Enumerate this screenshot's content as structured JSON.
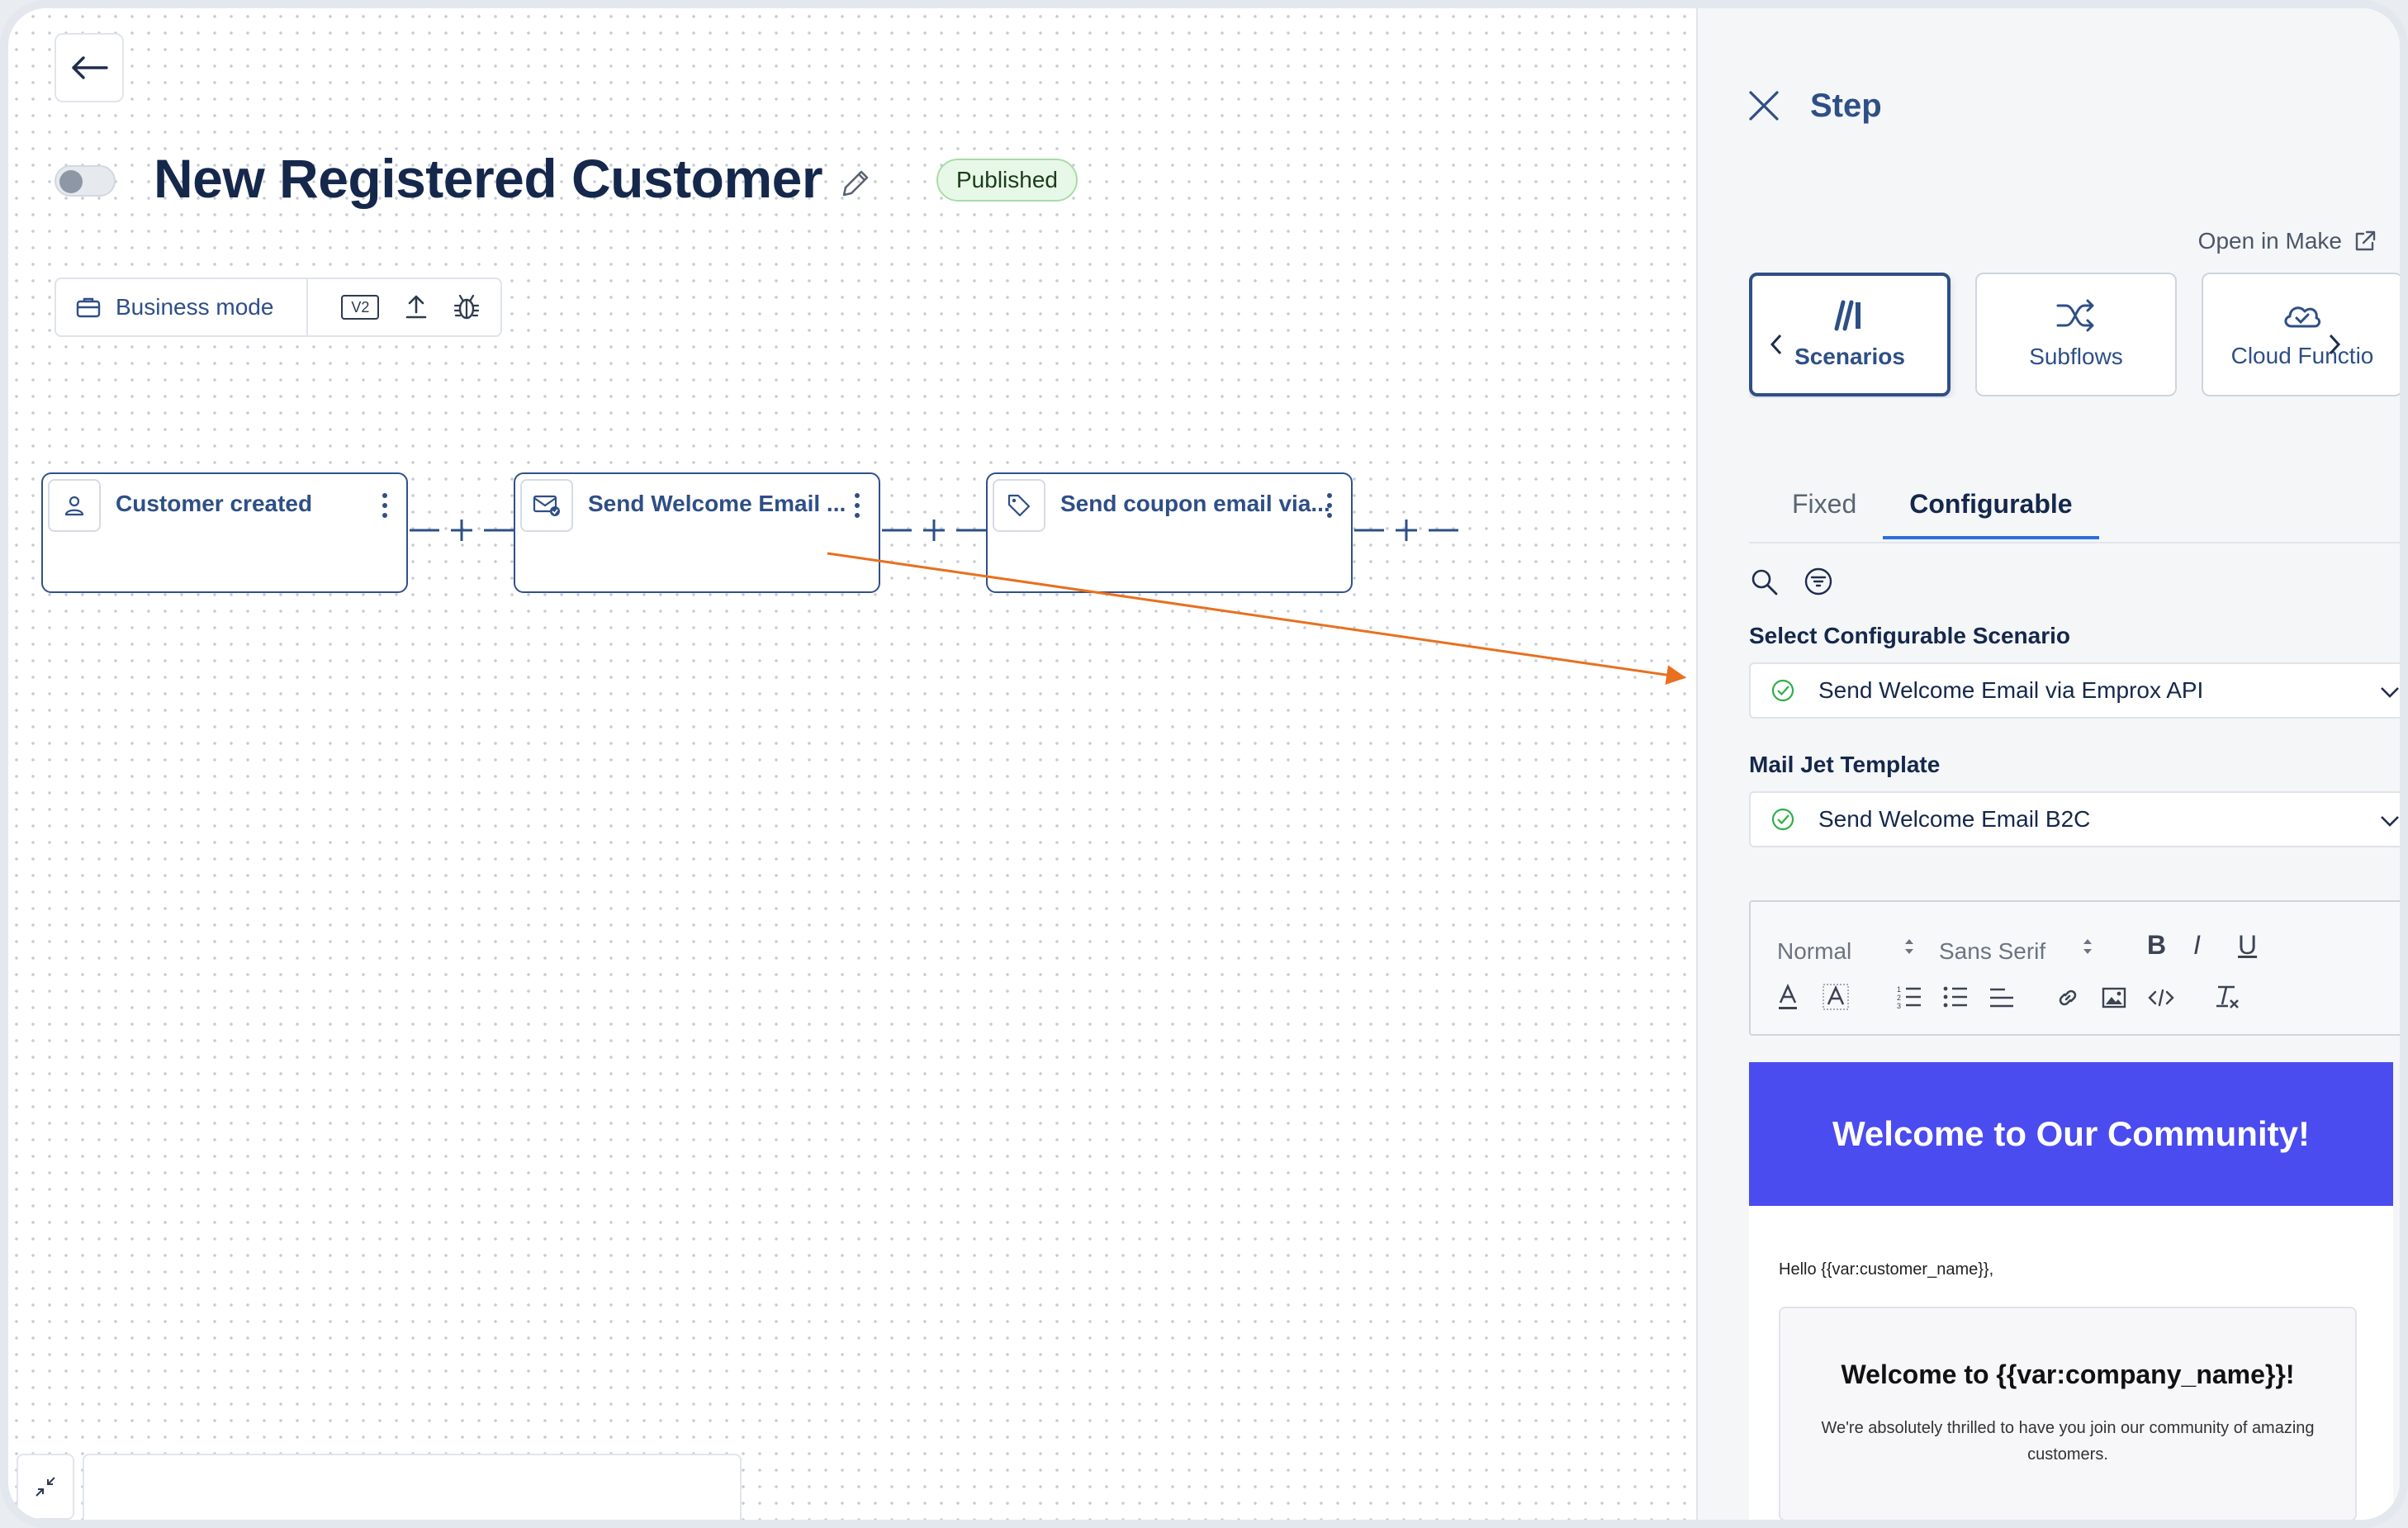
{
  "workflow": {
    "title": "New Registered Customer",
    "status": "Published",
    "enabled": false
  },
  "toolbar": {
    "mode_label": "Business mode",
    "version_label": "V2"
  },
  "nodes": [
    {
      "label": "Customer created",
      "icon": "user-icon"
    },
    {
      "label": "Send Welcome Email ...",
      "icon": "email-icon"
    },
    {
      "label": "Send coupon email via...",
      "icon": "tag-icon"
    }
  ],
  "connector": {
    "symbol": "+"
  },
  "panel": {
    "title": "Step",
    "open_in_make": "Open in Make",
    "categories": [
      {
        "label": "Scenarios",
        "icon": "scenarios-icon",
        "active": true
      },
      {
        "label": "Subflows",
        "icon": "shuffle-icon",
        "active": false
      },
      {
        "label": "Cloud Functio",
        "icon": "cloud-icon",
        "active": false
      }
    ],
    "tabs": [
      {
        "label": "Fixed",
        "active": false
      },
      {
        "label": "Configurable",
        "active": true
      }
    ],
    "scenario_label": "Select Configurable Scenario",
    "scenario_value": "Send Welcome Email via Emprox API",
    "template_label": "Mail Jet Template",
    "template_value": "Send Welcome Email B2C",
    "editor": {
      "format": "Normal",
      "font": "Sans Serif",
      "bold": "B",
      "italic": "I",
      "underline": "U"
    },
    "email": {
      "hero": "Welcome to Our Community!",
      "hello": "Hello {{var:customer_name}},",
      "heading": "Welcome to {{var:company_name}}!",
      "body": "We're absolutely thrilled to have you join our community of amazing customers."
    }
  },
  "colors": {
    "primary": "#2e4f86",
    "title": "#15284b",
    "badge_bg": "#e8f8e8",
    "email_hero": "#4a4cf0",
    "arrow": "#e8701f",
    "tab_underline": "#2e6fd9"
  }
}
